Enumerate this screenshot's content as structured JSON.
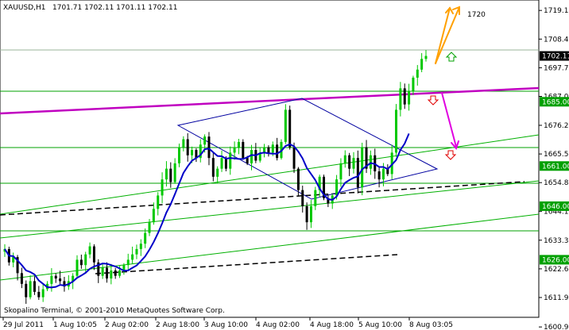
{
  "header": {
    "symbol": "XAUUSD,H1",
    "ohlc": "1701.71 1702.11 1701.11 1702.11"
  },
  "footer": {
    "copyright": "Skopalino Terminal, © 2001-2010 MetaQuotes Software Corp."
  },
  "annotation": {
    "target_label": "1720"
  },
  "colors": {
    "bull": "#00c800",
    "bear": "#000000",
    "ma": "#0000c8",
    "hline": "#00a000",
    "channel": "#00b000",
    "magenta": "#c000c0",
    "orange": "#ffa000",
    "wedge": "#0000a0",
    "dashed": "#000000",
    "price_tag": "#000000",
    "arrow_up": "#00a000",
    "arrow_down": "#e00000"
  },
  "chart_data": {
    "type": "candlestick",
    "symbol": "XAUUSD",
    "timeframe": "H1",
    "ylim": [
      1604.5,
      1723
    ],
    "y_ticks": [
      1719.1,
      1708.4,
      1697.7,
      1687.0,
      1676.2,
      1665.5,
      1654.8,
      1644.1,
      1633.3,
      1622.6,
      1611.9,
      1600.9
    ],
    "x_ticks": [
      "29 Jul 2011",
      "1 Aug 10:05",
      "2 Aug 02:00",
      "2 Aug 18:00",
      "3 Aug 10:00",
      "4 Aug 02:00",
      "4 Aug 18:00",
      "5 Aug 10:00",
      "8 Aug 03:05"
    ],
    "level_labels": [
      {
        "value": 1702.11,
        "text": "1702.11",
        "style": "current"
      },
      {
        "value": 1685.0,
        "text": "1685.00",
        "style": "level"
      },
      {
        "value": 1661.0,
        "text": "1661.00",
        "style": "level"
      },
      {
        "value": 1646.0,
        "text": "1646.00",
        "style": "level"
      },
      {
        "value": 1626.0,
        "text": "1626.00",
        "style": "level"
      }
    ],
    "closes": [
      1630,
      1625,
      1627,
      1621,
      1617,
      1612,
      1618,
      1614,
      1612,
      1615,
      1617,
      1620,
      1619,
      1618,
      1616,
      1618,
      1620,
      1626,
      1624,
      1628,
      1631,
      1625,
      1620,
      1623,
      1619,
      1622,
      1620,
      1622,
      1624,
      1626,
      1628,
      1630,
      1632,
      1636,
      1640,
      1645,
      1650,
      1656,
      1660,
      1655,
      1662,
      1668,
      1671,
      1665,
      1667,
      1664,
      1669,
      1672,
      1664,
      1657,
      1660,
      1664,
      1660,
      1666,
      1668,
      1670,
      1664,
      1662,
      1667,
      1663,
      1666,
      1668,
      1666,
      1669,
      1664,
      1670,
      1682,
      1668,
      1660,
      1652,
      1646,
      1640,
      1646,
      1652,
      1657,
      1649,
      1647,
      1650,
      1656,
      1662,
      1665,
      1660,
      1664,
      1653,
      1668,
      1660,
      1665,
      1659,
      1656,
      1660,
      1658,
      1666,
      1682,
      1690,
      1684,
      1689,
      1694,
      1697,
      1701,
      1702.11
    ]
  }
}
